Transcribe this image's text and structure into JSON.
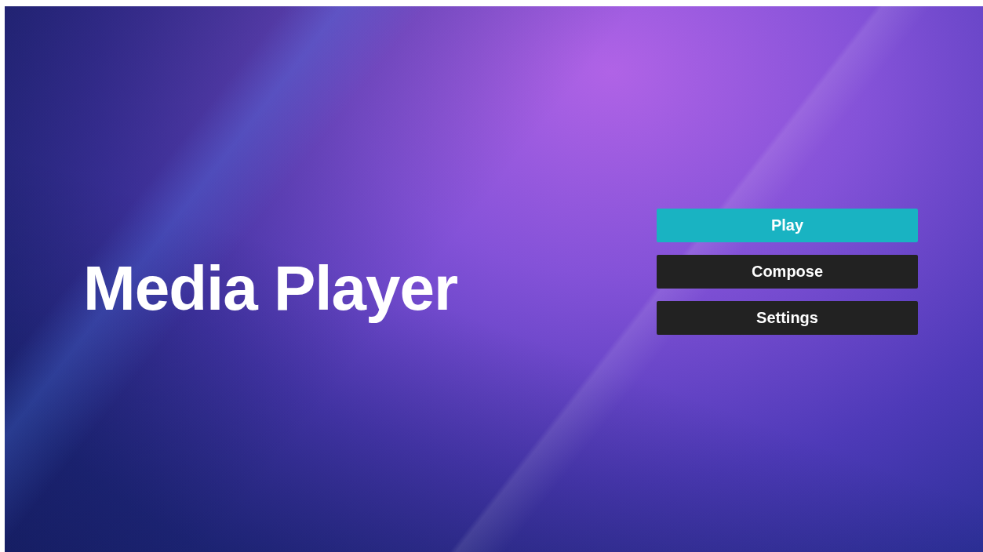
{
  "title": "Media Player",
  "menu": [
    {
      "label": "Play",
      "selected": true
    },
    {
      "label": "Compose",
      "selected": false
    },
    {
      "label": "Settings",
      "selected": false
    }
  ]
}
